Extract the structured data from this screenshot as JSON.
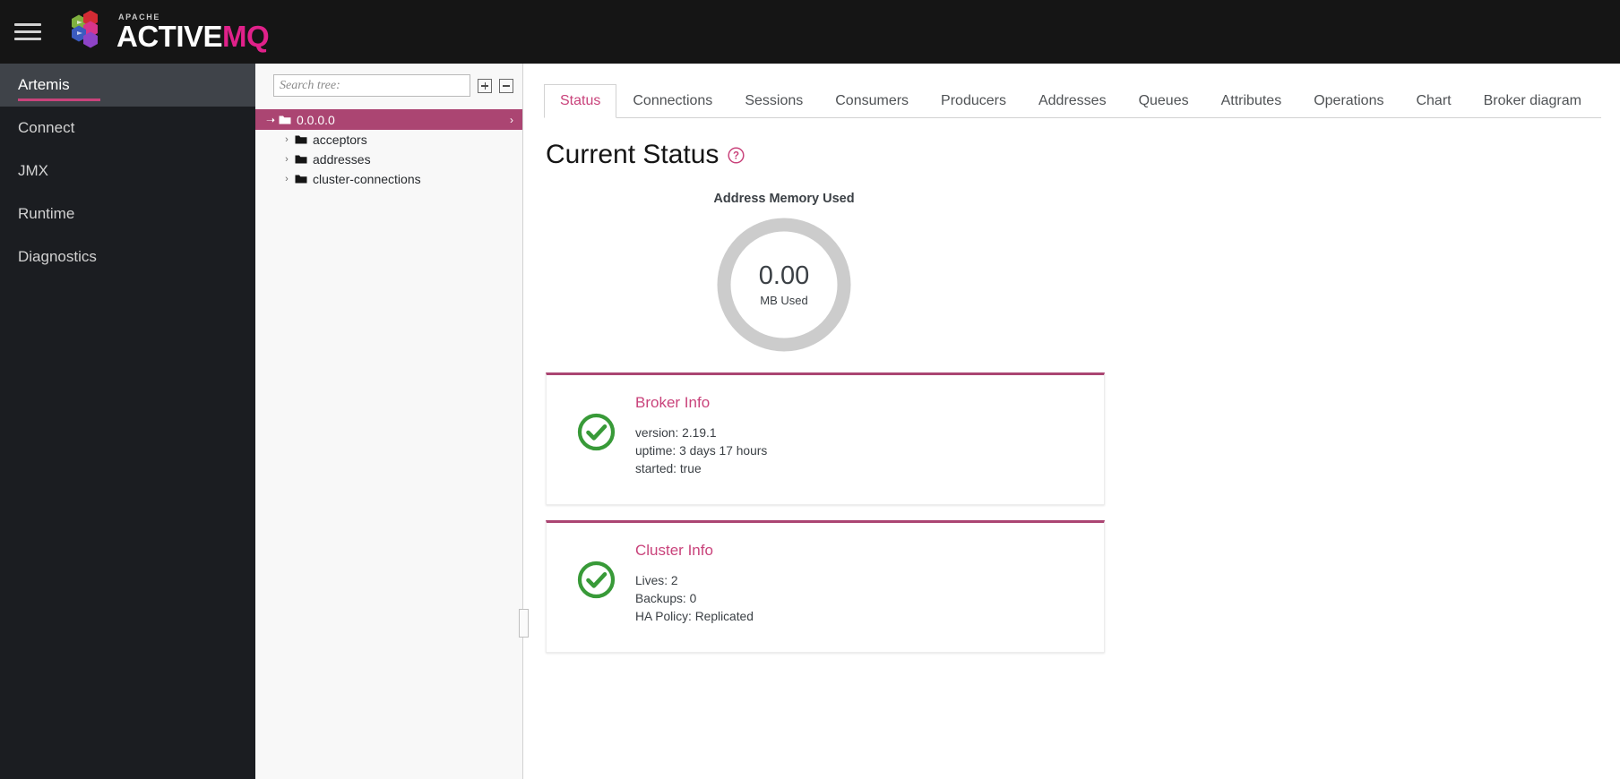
{
  "masthead": {
    "menu_icon": "hamburger-icon",
    "logo_icon": "activemq-hexagon-logo",
    "apache_label": "APACHE",
    "brand_first": "ACTIVE",
    "brand_second": "MQ",
    "background": "#151515"
  },
  "sidebar": {
    "background": "#1b1d21",
    "active_background": "#3f4349",
    "active_underline_color": "#c9437b",
    "items": [
      {
        "label": "Artemis",
        "active": true
      },
      {
        "label": "Connect",
        "active": false
      },
      {
        "label": "JMX",
        "active": false
      },
      {
        "label": "Runtime",
        "active": false
      },
      {
        "label": "Diagnostics",
        "active": false
      }
    ]
  },
  "tree_panel": {
    "search": {
      "value": "",
      "placeholder": "Search tree:"
    },
    "expand_all_label": "+",
    "collapse_all_label": "-",
    "selected_color": "#ab4572",
    "nodes": [
      {
        "label": "0.0.0.0",
        "expanded": true,
        "selected": true,
        "depth": 0,
        "chevron": "chevron-down-icon",
        "tail_chevron": "chevron-right-icon"
      },
      {
        "label": "acceptors",
        "expanded": false,
        "selected": false,
        "depth": 1,
        "chevron": "chevron-right-icon"
      },
      {
        "label": "addresses",
        "expanded": false,
        "selected": false,
        "depth": 1,
        "chevron": "chevron-right-icon"
      },
      {
        "label": "cluster-connections",
        "expanded": false,
        "selected": false,
        "depth": 1,
        "chevron": "chevron-right-icon"
      }
    ]
  },
  "main": {
    "tabs": [
      {
        "label": "Status",
        "active": true
      },
      {
        "label": "Connections",
        "active": false
      },
      {
        "label": "Sessions",
        "active": false
      },
      {
        "label": "Consumers",
        "active": false
      },
      {
        "label": "Producers",
        "active": false
      },
      {
        "label": "Addresses",
        "active": false
      },
      {
        "label": "Queues",
        "active": false
      },
      {
        "label": "Attributes",
        "active": false
      },
      {
        "label": "Operations",
        "active": false
      },
      {
        "label": "Chart",
        "active": false
      },
      {
        "label": "Broker diagram",
        "active": false
      }
    ],
    "page_title": "Current Status",
    "help_icon": "question-circle-icon",
    "accent_color": "#c9437b",
    "gauge": {
      "title": "Address Memory Used",
      "value": "0.00",
      "unit": "MB Used",
      "percent": 0,
      "track_color": "#cccccc",
      "fill_color": "#c9437b"
    },
    "cards": [
      {
        "title": "Broker Info",
        "icon": "check-circle-icon",
        "icon_color": "#389a38",
        "lines": [
          "version: 2.19.1",
          "uptime: 3 days 17 hours",
          "started: true"
        ]
      },
      {
        "title": "Cluster Info",
        "icon": "check-circle-icon",
        "icon_color": "#389a38",
        "lines": [
          "Lives: 2",
          "Backups: 0",
          "HA Policy: Replicated"
        ]
      }
    ]
  }
}
